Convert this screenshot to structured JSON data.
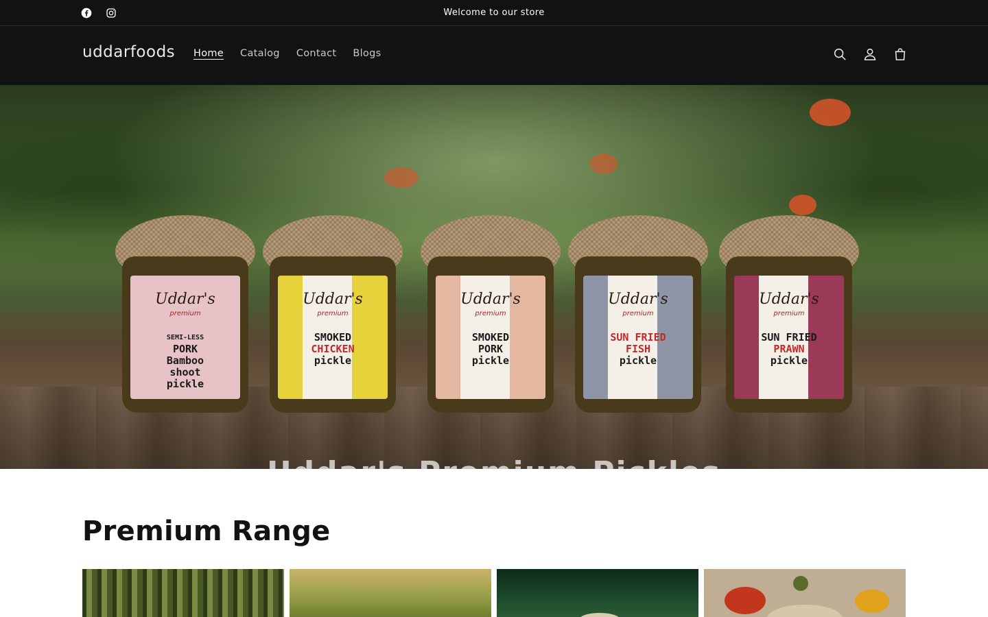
{
  "announcement": {
    "text": "Welcome to our store",
    "social": [
      {
        "name": "facebook-icon"
      },
      {
        "name": "instagram-icon"
      }
    ]
  },
  "header": {
    "logo": "uddarfoods",
    "nav": [
      {
        "label": "Home",
        "active": true
      },
      {
        "label": "Catalog",
        "active": false
      },
      {
        "label": "Contact",
        "active": false
      },
      {
        "label": "Blogs",
        "active": false
      }
    ],
    "icons": [
      "search-icon",
      "account-icon",
      "cart-icon"
    ]
  },
  "hero": {
    "overlay_text": "Uddar's Premium Pickles",
    "jars": [
      {
        "brand": "Uddar's",
        "sub": "premium",
        "line1": "SEMI-LESS",
        "line2": "PORK",
        "line3": "Bamboo",
        "line4": "shoot",
        "line5": "pickle",
        "color": "#e7c3c7"
      },
      {
        "brand": "Uddar's",
        "sub": "premium",
        "line1": "SMOKED",
        "line2": "CHICKEN",
        "line3": "pickle",
        "line4": "",
        "line5": "",
        "color": "#e6d23a"
      },
      {
        "brand": "Uddar's",
        "sub": "premium",
        "line1": "SMOKED",
        "line2": "PORK",
        "line3": "pickle",
        "line4": "",
        "line5": "",
        "color": "#e4b8a0"
      },
      {
        "brand": "Uddar's",
        "sub": "premium",
        "line1": "SUN FRIED",
        "line2": "FISH",
        "line3": "pickle",
        "line4": "",
        "line5": "",
        "color": "#8e95a6"
      },
      {
        "brand": "Uddar's",
        "sub": "premium",
        "line1": "SUN FRIED",
        "line2": "PRAWN",
        "line3": "pickle",
        "line4": "",
        "line5": "",
        "color": "#9a3a56"
      }
    ]
  },
  "premium": {
    "title": "Premium Range"
  },
  "colors": {
    "header_bg": "#121212",
    "text_light": "#ffffff",
    "text_dark": "#121212"
  }
}
